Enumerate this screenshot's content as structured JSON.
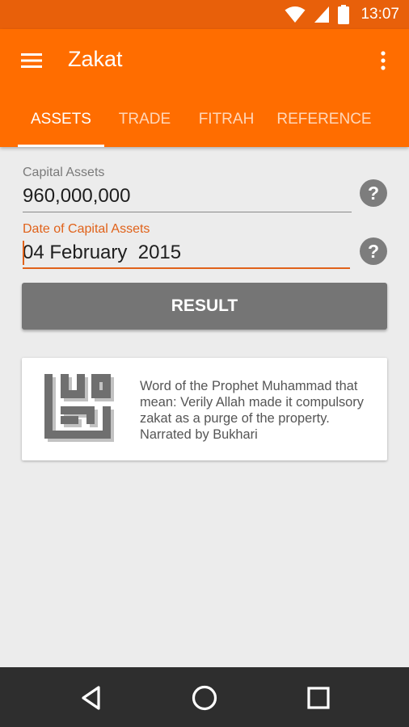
{
  "status": {
    "time": "13:07",
    "icons": [
      "wifi-icon",
      "signal-icon",
      "battery-icon"
    ]
  },
  "app": {
    "title": "Zakat",
    "menu_icon": "hamburger-menu-icon",
    "more_icon": "more-vert-icon"
  },
  "tabs": [
    {
      "label": "ASSETS",
      "active": true
    },
    {
      "label": "TRADE",
      "active": false
    },
    {
      "label": "FITRAH",
      "active": false
    },
    {
      "label": "REFERENCE",
      "active": false
    }
  ],
  "form": {
    "capital_assets": {
      "label": "Capital Assets",
      "value": "960,000,000"
    },
    "date": {
      "label": "Date of Capital Assets",
      "value": "04 February  2015"
    },
    "help_symbol": "?"
  },
  "result_button": {
    "label": "RESULT"
  },
  "quote": {
    "text": "Word of the Prophet Muhammad that mean: Verily Allah made it compulsory zakat as a purge of the property. Narrated by Bukhari"
  },
  "nav": [
    "back-icon",
    "home-icon",
    "recents-icon"
  ],
  "colors": {
    "primary": "#ff6d00",
    "status_bar": "#e8600a",
    "accent": "#e0621a",
    "button": "#757575",
    "background": "#ececec"
  }
}
